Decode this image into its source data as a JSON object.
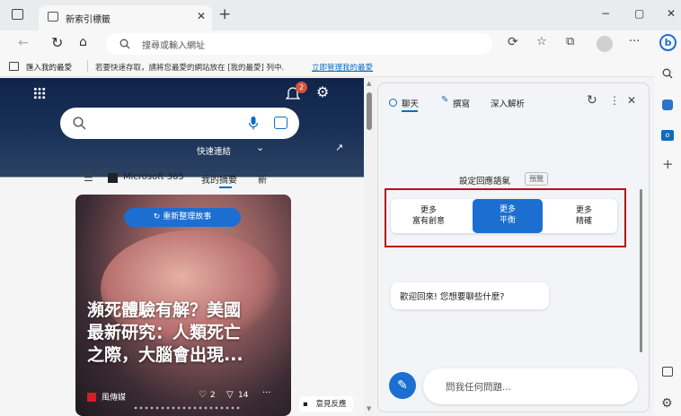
{
  "tab": {
    "title": "新索引標籤"
  },
  "window_controls": {
    "minimize": "−",
    "maximize": "▢",
    "close": "✕"
  },
  "address": {
    "placeholder": "搜尋或輸入網址"
  },
  "favorites": {
    "import_label": "匯入我的最愛",
    "hint_text": "若要快速存取，請將您最愛的網站放在 [我的最愛] 列中.",
    "link_text": "立即管理我的最愛"
  },
  "newtab": {
    "notification_count": "2",
    "quick_links": "快速連結",
    "nav": {
      "ms365": "Microsoft 365",
      "myfeed": "我的摘要",
      "more": "新"
    },
    "refresh_story": "重新整理故事",
    "headline_lines": [
      "瀕死體驗有解？美國",
      "最新研究：人類死亡",
      "之際，大腦會出現..."
    ],
    "source": "風傳媒",
    "likes": "2",
    "comments": "14",
    "feedback": "意見反應"
  },
  "copilot": {
    "tabs": [
      "聊天",
      "撰寫",
      "深入解析"
    ],
    "tone_label": "設定回應語氣",
    "tone_badge": "預覽",
    "tones": [
      {
        "line1": "更多",
        "line2": "富有創意"
      },
      {
        "line1": "更多",
        "line2": "平衡"
      },
      {
        "line1": "更多",
        "line2": "精確"
      }
    ],
    "welcome": "歡迎回來! 您想要聊些什麼?",
    "input_placeholder": "問我任何問題..."
  },
  "colors": {
    "accent": "#0f6cbd",
    "highlight_border": "#b5121b"
  }
}
